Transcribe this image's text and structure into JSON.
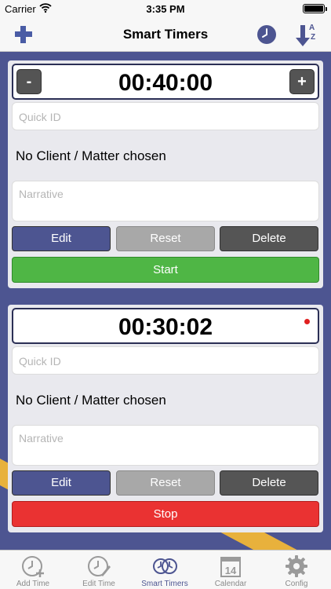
{
  "status": {
    "carrier": "Carrier",
    "time": "3:35 PM"
  },
  "nav": {
    "title": "Smart Timers"
  },
  "timers": [
    {
      "time": "00:40:00",
      "minus": "-",
      "plus": "+",
      "quick_id_placeholder": "Quick ID",
      "client": "No Client / Matter chosen",
      "narrative_placeholder": "Narrative",
      "edit": "Edit",
      "reset": "Reset",
      "delete": "Delete",
      "action": "Start"
    },
    {
      "time": "00:30:02",
      "quick_id_placeholder": "Quick ID",
      "client": "No Client / Matter chosen",
      "narrative_placeholder": "Narrative",
      "edit": "Edit",
      "reset": "Reset",
      "delete": "Delete",
      "action": "Stop"
    }
  ],
  "tabs": [
    {
      "label": "Add Time",
      "icon": "add-time-icon"
    },
    {
      "label": "Edit Time",
      "icon": "edit-time-icon"
    },
    {
      "label": "Smart Timers",
      "icon": "smart-timers-icon"
    },
    {
      "label": "Calendar",
      "icon": "calendar-icon",
      "day": "14"
    },
    {
      "label": "Config",
      "icon": "gear-icon"
    }
  ],
  "colors": {
    "accent": "#4d5591",
    "start": "#4fb645",
    "stop": "#ea3232",
    "stripe": "#e8b13c",
    "tab_active": "#4d5591"
  }
}
